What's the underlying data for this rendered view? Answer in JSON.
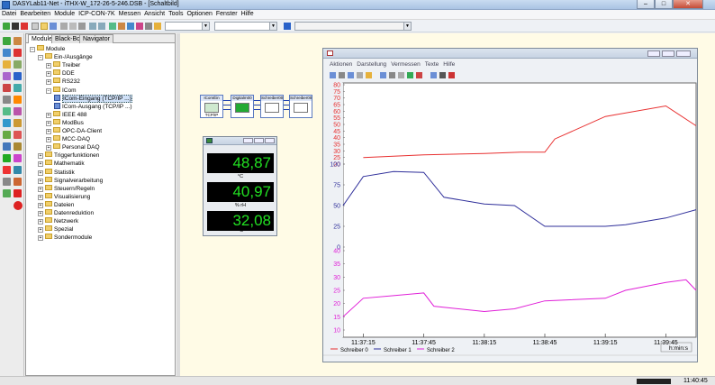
{
  "window": {
    "title": "DASYLab11-Net - iTHX-W_172-26-5-246.DSB - [Schaltbild]",
    "min_label": "–",
    "max_label": "□",
    "close_label": "✕"
  },
  "menubar": {
    "items": [
      "Datei",
      "Bearbeiten",
      "Module",
      "ICP-CON-7K",
      "Messen",
      "Ansicht",
      "Tools",
      "Optionen",
      "Fenster",
      "Hilfe"
    ]
  },
  "tree_panel": {
    "tabs": [
      "Module",
      "Black-Box",
      "Navigator"
    ],
    "nodes": [
      {
        "label": "Module",
        "level": 0,
        "expander": "−",
        "type": "folder"
      },
      {
        "label": "Ein-/Ausgänge",
        "level": 1,
        "expander": "−",
        "type": "folder"
      },
      {
        "label": "Treiber",
        "level": 2,
        "expander": "+",
        "type": "folder"
      },
      {
        "label": "DDE",
        "level": 2,
        "expander": "+",
        "type": "folder"
      },
      {
        "label": "RS232",
        "level": 2,
        "expander": "+",
        "type": "folder"
      },
      {
        "label": "ICom",
        "level": 2,
        "expander": "−",
        "type": "folder"
      },
      {
        "label": "ICom-Eingang (TCP/IP ...)",
        "level": 3,
        "expander": "",
        "type": "module",
        "selected": true
      },
      {
        "label": "ICom-Ausgang (TCP/IP ...)",
        "level": 3,
        "expander": "",
        "type": "module"
      },
      {
        "label": "IEEE 488",
        "level": 2,
        "expander": "+",
        "type": "folder"
      },
      {
        "label": "ModBus",
        "level": 2,
        "expander": "+",
        "type": "folder"
      },
      {
        "label": "OPC-DA-Client",
        "level": 2,
        "expander": "+",
        "type": "folder"
      },
      {
        "label": "MCC-DAQ",
        "level": 2,
        "expander": "+",
        "type": "folder"
      },
      {
        "label": "Personal DAQ",
        "level": 2,
        "expander": "+",
        "type": "folder"
      },
      {
        "label": "Triggerfunktionen",
        "level": 1,
        "expander": "+",
        "type": "folder"
      },
      {
        "label": "Mathematik",
        "level": 1,
        "expander": "+",
        "type": "folder"
      },
      {
        "label": "Statistik",
        "level": 1,
        "expander": "+",
        "type": "folder"
      },
      {
        "label": "Signalverarbeitung",
        "level": 1,
        "expander": "+",
        "type": "folder"
      },
      {
        "label": "Steuern/Regeln",
        "level": 1,
        "expander": "+",
        "type": "folder"
      },
      {
        "label": "Visualisierung",
        "level": 1,
        "expander": "+",
        "type": "folder"
      },
      {
        "label": "Dateien",
        "level": 1,
        "expander": "+",
        "type": "folder"
      },
      {
        "label": "Datenreduktion",
        "level": 1,
        "expander": "+",
        "type": "folder"
      },
      {
        "label": "Netzwerk",
        "level": 1,
        "expander": "+",
        "type": "folder"
      },
      {
        "label": "Spezial",
        "level": 1,
        "expander": "+",
        "type": "folder"
      },
      {
        "label": "Sondermodule",
        "level": 1,
        "expander": "+",
        "type": "folder"
      }
    ]
  },
  "blocks": [
    {
      "title": "IComÉin",
      "label": "TCP/IP"
    },
    {
      "title": "Digitalm00",
      "label": ""
    },
    {
      "title": "Schreiber00",
      "label": ""
    },
    {
      "title": "Schreiber00",
      "label": ""
    }
  ],
  "meter": {
    "displays": [
      {
        "value": "48,87",
        "unit": "°C"
      },
      {
        "value": "40,97",
        "unit": "% rH"
      },
      {
        "value": "32,08",
        "unit": "°C"
      }
    ]
  },
  "chart_window": {
    "menu": [
      "Aktionen",
      "Darstellung",
      "Vermessen",
      "Texte",
      "Hilfe"
    ],
    "time_unit": "h:min:s",
    "legend": [
      {
        "name": "Schreiber 0",
        "color": "#e83030"
      },
      {
        "name": "Schreiber 1",
        "color": "#2f2f9a"
      },
      {
        "name": "Schreiber 2",
        "color": "#e020d8"
      }
    ]
  },
  "chart_data": [
    {
      "type": "line",
      "name": "Schreiber 0",
      "color": "#e83030",
      "ylim": [
        20,
        80
      ],
      "yticks": [
        80,
        75,
        70,
        65,
        60,
        55,
        50,
        45,
        40,
        35,
        30,
        25,
        20
      ],
      "x": [
        "11:37:15",
        "11:37:45",
        "11:38:15",
        "11:38:33",
        "11:38:45",
        "11:38:50",
        "11:39:15",
        "11:39:45",
        "11:40:00"
      ],
      "values": [
        25,
        27,
        28,
        29,
        29,
        39,
        56,
        64,
        49
      ]
    },
    {
      "type": "line",
      "name": "Schreiber 1",
      "color": "#2f2f9a",
      "ylim": [
        0,
        100
      ],
      "yticks": [
        100,
        75,
        50,
        25,
        0
      ],
      "x": [
        "11:37:05",
        "11:37:15",
        "11:37:30",
        "11:37:45",
        "11:37:55",
        "11:38:15",
        "11:38:30",
        "11:38:45",
        "11:39:15",
        "11:39:25",
        "11:39:45",
        "11:40:00"
      ],
      "values": [
        50,
        85,
        91,
        90,
        60,
        52,
        50,
        25,
        25,
        27,
        35,
        45
      ]
    },
    {
      "type": "line",
      "name": "Schreiber 2",
      "color": "#e020d8",
      "ylim": [
        10,
        40
      ],
      "yticks": [
        40,
        35,
        30,
        25,
        20,
        15,
        10
      ],
      "x": [
        "11:37:05",
        "11:37:15",
        "11:37:30",
        "11:37:45",
        "11:37:50",
        "11:38:15",
        "11:38:30",
        "11:38:45",
        "11:39:15",
        "11:39:25",
        "11:39:45",
        "11:39:55",
        "11:40:00"
      ],
      "values": [
        15,
        22,
        23,
        24,
        19,
        17,
        18,
        21,
        22,
        25,
        28,
        29,
        25
      ]
    }
  ],
  "time_ticks": [
    "11:37:15",
    "11:37:45",
    "11:38:15",
    "11:38:45",
    "11:39:15",
    "11:39:45"
  ],
  "statusbar": {
    "clock": "11:40:45"
  }
}
